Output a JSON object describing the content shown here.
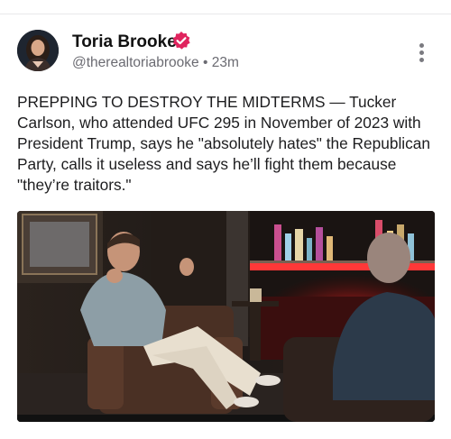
{
  "post": {
    "author": {
      "name": "Toria Brooke",
      "handle": "@therealtoriabrooke",
      "separator": "•",
      "time": "23m",
      "verified": true,
      "verified_color": "#e0245e"
    },
    "text": "PREPPING TO DESTROY THE MIDTERMS — Tucker Carlson, who attended UFC 295 in November of 2023 with President Trump, says he \"absolutely hates\" the Republican Party, calls it useless and says he’ll fight them because \"they’re traitors.\"",
    "icons": {
      "more": "more-vertical-icon",
      "verified": "verified-badge-icon"
    },
    "media": {
      "type": "video-still"
    }
  },
  "colors": {
    "name": "#111111",
    "meta": "#6b6b72",
    "badge": "#e0245e",
    "divider": "#e8e8ea"
  }
}
